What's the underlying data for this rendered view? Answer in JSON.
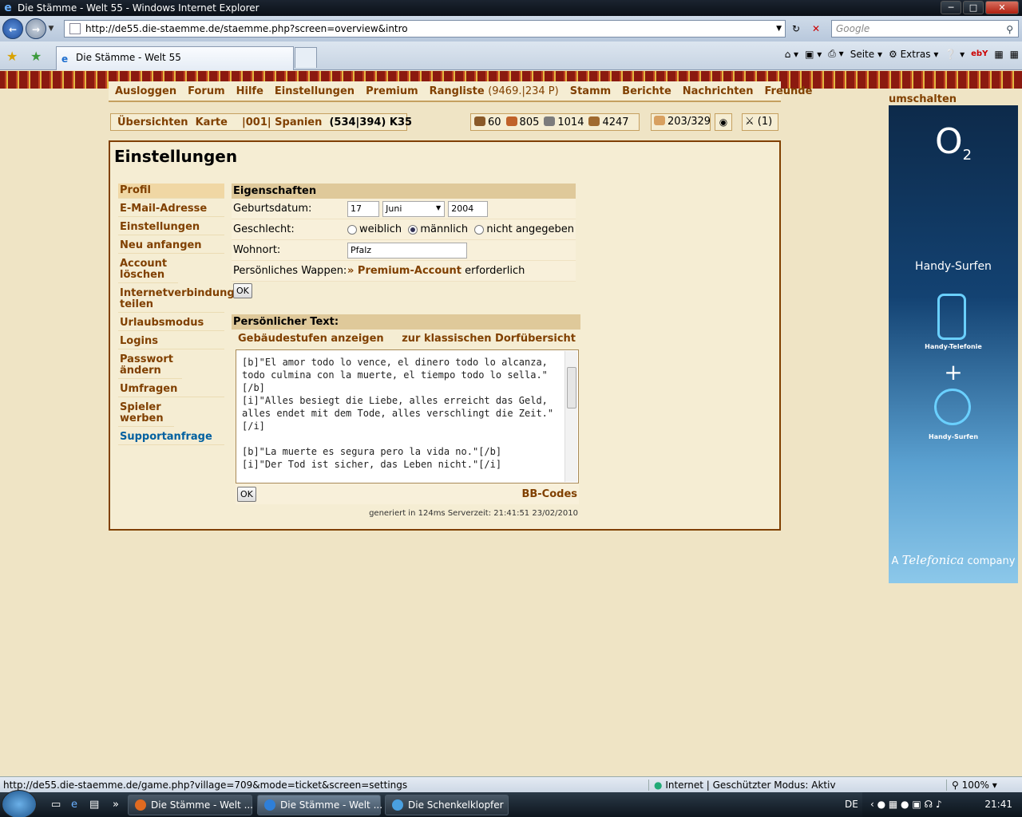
{
  "window": {
    "title": "Die Stämme - Welt 55 - Windows Internet Explorer"
  },
  "browser": {
    "url": "http://de55.die-staemme.de/staemme.php?screen=overview&intro",
    "search_placeholder": "Google",
    "tab_title": "Die Stämme - Welt 55",
    "cmd": {
      "page": "Seite",
      "extras": "Extras"
    }
  },
  "menu": {
    "logout": "Ausloggen",
    "forum": "Forum",
    "help": "Hilfe",
    "settings": "Einstellungen",
    "premium": "Premium",
    "ranking": "Rangliste",
    "ranking_detail": "(9469.|234 P)",
    "tribe": "Stamm",
    "reports": "Berichte",
    "messages": "Nachrichten",
    "friends": "Freunde"
  },
  "infobar": {
    "overviews": "Übersichten",
    "map": "Karte",
    "village": "|001| Spanien",
    "coords": "(534|394) K35"
  },
  "resources": {
    "wood": "60",
    "clay": "805",
    "iron": "1014",
    "storage": "4247",
    "population": "203/329",
    "attacks": "(1)"
  },
  "main": {
    "title": "Einstellungen",
    "sidebar": [
      {
        "label": "Profil"
      },
      {
        "label": "E-Mail-Adresse"
      },
      {
        "label": "Einstellungen"
      },
      {
        "label": "Neu anfangen"
      },
      {
        "label": "Account löschen"
      },
      {
        "label": "Internetverbindung teilen"
      },
      {
        "label": "Urlaubsmodus"
      },
      {
        "label": "Logins"
      },
      {
        "label": "Passwort ändern"
      },
      {
        "label": "Umfragen"
      },
      {
        "label": "Spieler werben"
      },
      {
        "label": "Supportanfrage"
      }
    ],
    "props": {
      "header": "Eigenschaften",
      "birthday_label": "Geburtsdatum:",
      "day": "17",
      "month": "Juni",
      "year": "2004",
      "gender_label": "Geschlecht:",
      "gender_options": [
        "weiblich",
        "männlich",
        "nicht angegeben"
      ],
      "city_label": "Wohnort:",
      "city": "Pfalz",
      "coat_label": "Persönliches Wappen:",
      "coat_link": "» Premium-Account",
      "coat_suffix": "erforderlich",
      "ok": "OK"
    },
    "ptext": {
      "header": "Persönlicher Text:",
      "link_left": "Gebäudestufen anzeigen",
      "link_right": "zur klassischen Dorfübersicht",
      "text": "[b]\"El amor todo lo vence, el dinero todo lo alcanza, todo culmina con la muerte, el tiempo todo lo sella.\" [/b]\n[i]\"Alles besiegt die Liebe, alles erreicht das Geld, alles endet mit dem Tode, alles verschlingt die Zeit.\" [/i]\n\n[b]\"La muerte es segura pero la vida no.\"[/b]\n[i]\"Der Tod ist sicher, das Leben nicht.\"[/i]",
      "ok": "OK",
      "bbcodes": "BB-Codes"
    },
    "server_info": "generiert in 124ms Serverzeit: 21:41:51 23/02/2010"
  },
  "ad": {
    "switch": "umschalten",
    "brand": "O",
    "brand_sub": "2",
    "headline": "Handy-Surfen",
    "phone_label": "Handy-Telefonie",
    "plus": "+",
    "surf_label": "Handy-Surfen",
    "footer_a": "A",
    "footer_brand": "Telefonica",
    "footer_company": "company"
  },
  "status": {
    "url": "http://de55.die-staemme.de/game.php?village=709&mode=ticket&screen=settings",
    "zone": "Internet | Geschützter Modus: Aktiv",
    "zoom": "100%"
  },
  "taskbar": {
    "items": [
      "Die Stämme - Welt ...",
      "Die Stämme - Welt ...",
      "Die Schenkelklopfer"
    ],
    "lang": "DE",
    "clock": "21:41"
  }
}
